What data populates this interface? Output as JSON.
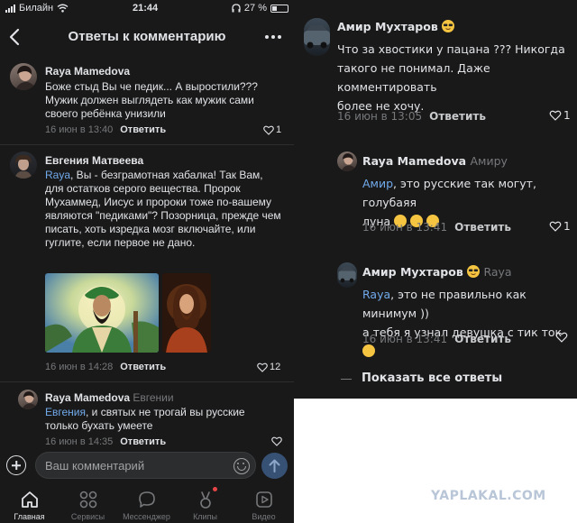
{
  "status_bar": {
    "carrier": "Билайн",
    "time": "21:44",
    "battery": "27 %"
  },
  "nav": {
    "title": "Ответы к комментарию"
  },
  "comments_left": [
    {
      "author": "Raya Mamedova",
      "reply_to": "",
      "mention": "",
      "text": "Боже стыд Вы че педик... А выростили??? Мужик должен выглядеть как мужик сами своего ребёнка унизили",
      "date": "16 июн в 13:40",
      "reply_label": "Ответить",
      "likes": "1"
    },
    {
      "author": "Евгения Матвеева",
      "reply_to": "",
      "mention": "Raya",
      "text": ", Вы - безграмотная хабалка! Так Вам, для остатков серого вещества. Пророк Мухаммед, Иисус и пророки тоже по-вашему являются \"педиками\"? Позорница, прежде чем писать, хоть изредка мозг включайте, или гуглите, если первое не дано.",
      "date": "16 июн в 14:28",
      "reply_label": "Ответить",
      "likes": "12"
    },
    {
      "author": "Raya Mamedova",
      "reply_to": "Евгении",
      "mention": "Евгения",
      "text": ", и святых не трогай вы русские только бухать умеете",
      "date": "16 июн в 14:35",
      "reply_label": "Ответить",
      "likes": ""
    }
  ],
  "compose": {
    "placeholder": "Ваш комментарий"
  },
  "tabbar": [
    {
      "label": "Главная",
      "icon": "home-icon"
    },
    {
      "label": "Сервисы",
      "icon": "services-icon"
    },
    {
      "label": "Мессенджер",
      "icon": "messenger-icon"
    },
    {
      "label": "Клипы",
      "icon": "clips-icon"
    },
    {
      "label": "Видео",
      "icon": "video-icon"
    }
  ],
  "comments_right": [
    {
      "author": "Амир Мухтаров",
      "reply_to": "",
      "mention": "",
      "text_lines": [
        "Что за хвостики у пацана ??? Никогда",
        "такого не понимал. Даже комментировать",
        "более не хочу."
      ],
      "date": "16 июн в 13:05",
      "reply_label": "Ответить",
      "likes": "1"
    },
    {
      "author": "Raya Mamedova",
      "reply_to": "Амиру",
      "mention": "Амир",
      "text_lines": [
        ", это русские так могут, голубаяя",
        "луна"
      ],
      "date": "16 июн в 13:41",
      "reply_label": "Ответить",
      "likes": "1"
    },
    {
      "author": "Амир Мухтаров",
      "reply_to": "Raya",
      "mention": "Raya",
      "text_lines": [
        ", это не правильно как минимум ))",
        "а тебя я узнал девушка с тик ток"
      ],
      "date": "16 июн в 13:41",
      "reply_label": "Ответить",
      "likes": ""
    }
  ],
  "show_all": "Показать все ответы",
  "watermark": "YAPLAKAL.COM",
  "colors": {
    "background": "#19191a",
    "text": "#e1e3e6",
    "secondary": "#76787a",
    "mention": "#71aaeb",
    "send_button": "#375175",
    "badge": "#e64646"
  }
}
